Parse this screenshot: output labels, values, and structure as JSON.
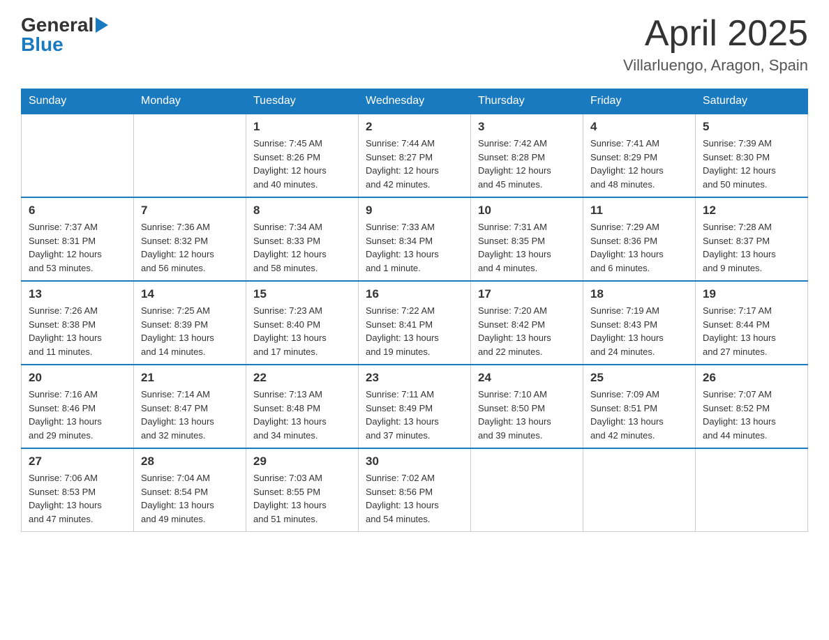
{
  "header": {
    "title": "April 2025",
    "subtitle": "Villarluengo, Aragon, Spain",
    "logo_general": "General",
    "logo_blue": "Blue"
  },
  "calendar": {
    "weekdays": [
      "Sunday",
      "Monday",
      "Tuesday",
      "Wednesday",
      "Thursday",
      "Friday",
      "Saturday"
    ],
    "weeks": [
      [
        {
          "day": "",
          "info": ""
        },
        {
          "day": "",
          "info": ""
        },
        {
          "day": "1",
          "info": "Sunrise: 7:45 AM\nSunset: 8:26 PM\nDaylight: 12 hours\nand 40 minutes."
        },
        {
          "day": "2",
          "info": "Sunrise: 7:44 AM\nSunset: 8:27 PM\nDaylight: 12 hours\nand 42 minutes."
        },
        {
          "day": "3",
          "info": "Sunrise: 7:42 AM\nSunset: 8:28 PM\nDaylight: 12 hours\nand 45 minutes."
        },
        {
          "day": "4",
          "info": "Sunrise: 7:41 AM\nSunset: 8:29 PM\nDaylight: 12 hours\nand 48 minutes."
        },
        {
          "day": "5",
          "info": "Sunrise: 7:39 AM\nSunset: 8:30 PM\nDaylight: 12 hours\nand 50 minutes."
        }
      ],
      [
        {
          "day": "6",
          "info": "Sunrise: 7:37 AM\nSunset: 8:31 PM\nDaylight: 12 hours\nand 53 minutes."
        },
        {
          "day": "7",
          "info": "Sunrise: 7:36 AM\nSunset: 8:32 PM\nDaylight: 12 hours\nand 56 minutes."
        },
        {
          "day": "8",
          "info": "Sunrise: 7:34 AM\nSunset: 8:33 PM\nDaylight: 12 hours\nand 58 minutes."
        },
        {
          "day": "9",
          "info": "Sunrise: 7:33 AM\nSunset: 8:34 PM\nDaylight: 13 hours\nand 1 minute."
        },
        {
          "day": "10",
          "info": "Sunrise: 7:31 AM\nSunset: 8:35 PM\nDaylight: 13 hours\nand 4 minutes."
        },
        {
          "day": "11",
          "info": "Sunrise: 7:29 AM\nSunset: 8:36 PM\nDaylight: 13 hours\nand 6 minutes."
        },
        {
          "day": "12",
          "info": "Sunrise: 7:28 AM\nSunset: 8:37 PM\nDaylight: 13 hours\nand 9 minutes."
        }
      ],
      [
        {
          "day": "13",
          "info": "Sunrise: 7:26 AM\nSunset: 8:38 PM\nDaylight: 13 hours\nand 11 minutes."
        },
        {
          "day": "14",
          "info": "Sunrise: 7:25 AM\nSunset: 8:39 PM\nDaylight: 13 hours\nand 14 minutes."
        },
        {
          "day": "15",
          "info": "Sunrise: 7:23 AM\nSunset: 8:40 PM\nDaylight: 13 hours\nand 17 minutes."
        },
        {
          "day": "16",
          "info": "Sunrise: 7:22 AM\nSunset: 8:41 PM\nDaylight: 13 hours\nand 19 minutes."
        },
        {
          "day": "17",
          "info": "Sunrise: 7:20 AM\nSunset: 8:42 PM\nDaylight: 13 hours\nand 22 minutes."
        },
        {
          "day": "18",
          "info": "Sunrise: 7:19 AM\nSunset: 8:43 PM\nDaylight: 13 hours\nand 24 minutes."
        },
        {
          "day": "19",
          "info": "Sunrise: 7:17 AM\nSunset: 8:44 PM\nDaylight: 13 hours\nand 27 minutes."
        }
      ],
      [
        {
          "day": "20",
          "info": "Sunrise: 7:16 AM\nSunset: 8:46 PM\nDaylight: 13 hours\nand 29 minutes."
        },
        {
          "day": "21",
          "info": "Sunrise: 7:14 AM\nSunset: 8:47 PM\nDaylight: 13 hours\nand 32 minutes."
        },
        {
          "day": "22",
          "info": "Sunrise: 7:13 AM\nSunset: 8:48 PM\nDaylight: 13 hours\nand 34 minutes."
        },
        {
          "day": "23",
          "info": "Sunrise: 7:11 AM\nSunset: 8:49 PM\nDaylight: 13 hours\nand 37 minutes."
        },
        {
          "day": "24",
          "info": "Sunrise: 7:10 AM\nSunset: 8:50 PM\nDaylight: 13 hours\nand 39 minutes."
        },
        {
          "day": "25",
          "info": "Sunrise: 7:09 AM\nSunset: 8:51 PM\nDaylight: 13 hours\nand 42 minutes."
        },
        {
          "day": "26",
          "info": "Sunrise: 7:07 AM\nSunset: 8:52 PM\nDaylight: 13 hours\nand 44 minutes."
        }
      ],
      [
        {
          "day": "27",
          "info": "Sunrise: 7:06 AM\nSunset: 8:53 PM\nDaylight: 13 hours\nand 47 minutes."
        },
        {
          "day": "28",
          "info": "Sunrise: 7:04 AM\nSunset: 8:54 PM\nDaylight: 13 hours\nand 49 minutes."
        },
        {
          "day": "29",
          "info": "Sunrise: 7:03 AM\nSunset: 8:55 PM\nDaylight: 13 hours\nand 51 minutes."
        },
        {
          "day": "30",
          "info": "Sunrise: 7:02 AM\nSunset: 8:56 PM\nDaylight: 13 hours\nand 54 minutes."
        },
        {
          "day": "",
          "info": ""
        },
        {
          "day": "",
          "info": ""
        },
        {
          "day": "",
          "info": ""
        }
      ]
    ]
  }
}
